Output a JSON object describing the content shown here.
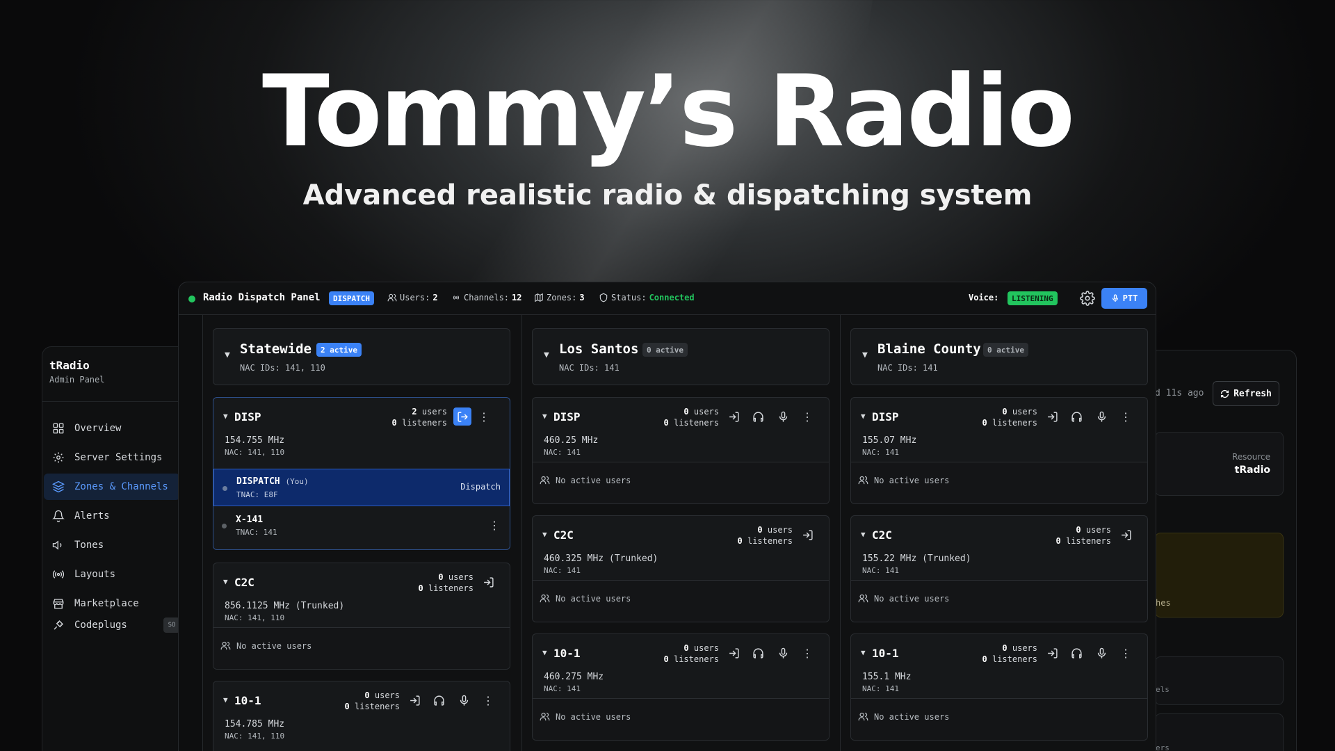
{
  "hero": {
    "title": "Tommy’s Radio",
    "subtitle": "Advanced realistic radio & dispatching system"
  },
  "colors": {
    "accent": "#3b82f6",
    "online": "#22c55e",
    "you_row": "#0d2a6b"
  },
  "admin": {
    "brand": "tRadio",
    "brand_sub": "Admin Panel",
    "nav": [
      {
        "label": "Overview",
        "icon": "grid-icon"
      },
      {
        "label": "Server Settings",
        "icon": "gear-icon"
      },
      {
        "label": "Zones & Channels",
        "icon": "layers-icon",
        "active": true
      },
      {
        "label": "Alerts",
        "icon": "bell-icon"
      },
      {
        "label": "Tones",
        "icon": "speaker-icon"
      },
      {
        "label": "Layouts",
        "icon": "broadcast-icon"
      },
      {
        "label": "Marketplace",
        "icon": "store-icon"
      },
      {
        "label": "Codeplugs",
        "icon": "plug-icon"
      }
    ],
    "codeplugs_tag": "SO"
  },
  "back_right": {
    "updated": "d 11s ago",
    "refresh": "Refresh",
    "resource_label": "Resource",
    "resource_value": "tRadio",
    "frag1": "hes",
    "frag2": "els",
    "frag3": "ers"
  },
  "topbar": {
    "title": "Radio Dispatch Panel",
    "role_badge": "DISPATCH",
    "users_label": "Users:",
    "users_value": "2",
    "channels_label": "Channels:",
    "channels_value": "12",
    "zones_label": "Zones:",
    "zones_value": "3",
    "status_label": "Status:",
    "status_value": "Connected",
    "voice_label": "Voice:",
    "voice_value": "LISTENING",
    "ptt": "PTT"
  },
  "zones": [
    {
      "name": "Statewide",
      "active": "2 active",
      "nac": "NAC IDs: 141, 110",
      "channels": [
        {
          "name": "DISP",
          "users": "2",
          "listeners": "0",
          "freq": "154.755 MHz",
          "nac": "NAC: 141, 110",
          "members": [
            {
              "name": "DISPATCH",
              "you": "(You)",
              "tnac": "TNAC: E8F",
              "role": "Dispatch"
            },
            {
              "name": "X-141",
              "tnac": "TNAC: 141"
            }
          ]
        },
        {
          "name": "C2C",
          "users": "0",
          "listeners": "0",
          "freq": "856.1125 MHz (Trunked)",
          "nac": "NAC: 141, 110",
          "empty": "No active users"
        },
        {
          "name": "10-1",
          "users": "0",
          "listeners": "0",
          "freq": "154.785 MHz",
          "nac": "NAC: 141, 110"
        }
      ]
    },
    {
      "name": "Los Santos",
      "active": "0 active",
      "nac": "NAC IDs: 141",
      "channels": [
        {
          "name": "DISP",
          "users": "0",
          "listeners": "0",
          "freq": "460.25 MHz",
          "nac": "NAC: 141",
          "empty": "No active users"
        },
        {
          "name": "C2C",
          "users": "0",
          "listeners": "0",
          "freq": "460.325 MHz (Trunked)",
          "nac": "NAC: 141",
          "empty": "No active users"
        },
        {
          "name": "10-1",
          "users": "0",
          "listeners": "0",
          "freq": "460.275 MHz",
          "nac": "NAC: 141",
          "empty": "No active users"
        }
      ]
    },
    {
      "name": "Blaine County",
      "active": "0 active",
      "nac": "NAC IDs: 141",
      "channels": [
        {
          "name": "DISP",
          "users": "0",
          "listeners": "0",
          "freq": "155.07 MHz",
          "nac": "NAC: 141",
          "empty": "No active users"
        },
        {
          "name": "C2C",
          "users": "0",
          "listeners": "0",
          "freq": "155.22 MHz (Trunked)",
          "nac": "NAC: 141",
          "empty": "No active users"
        },
        {
          "name": "10-1",
          "users": "0",
          "listeners": "0",
          "freq": "155.1 MHz",
          "nac": "NAC: 141",
          "empty": "No active users"
        }
      ]
    }
  ],
  "labels": {
    "users": "users",
    "listeners": "listeners"
  }
}
